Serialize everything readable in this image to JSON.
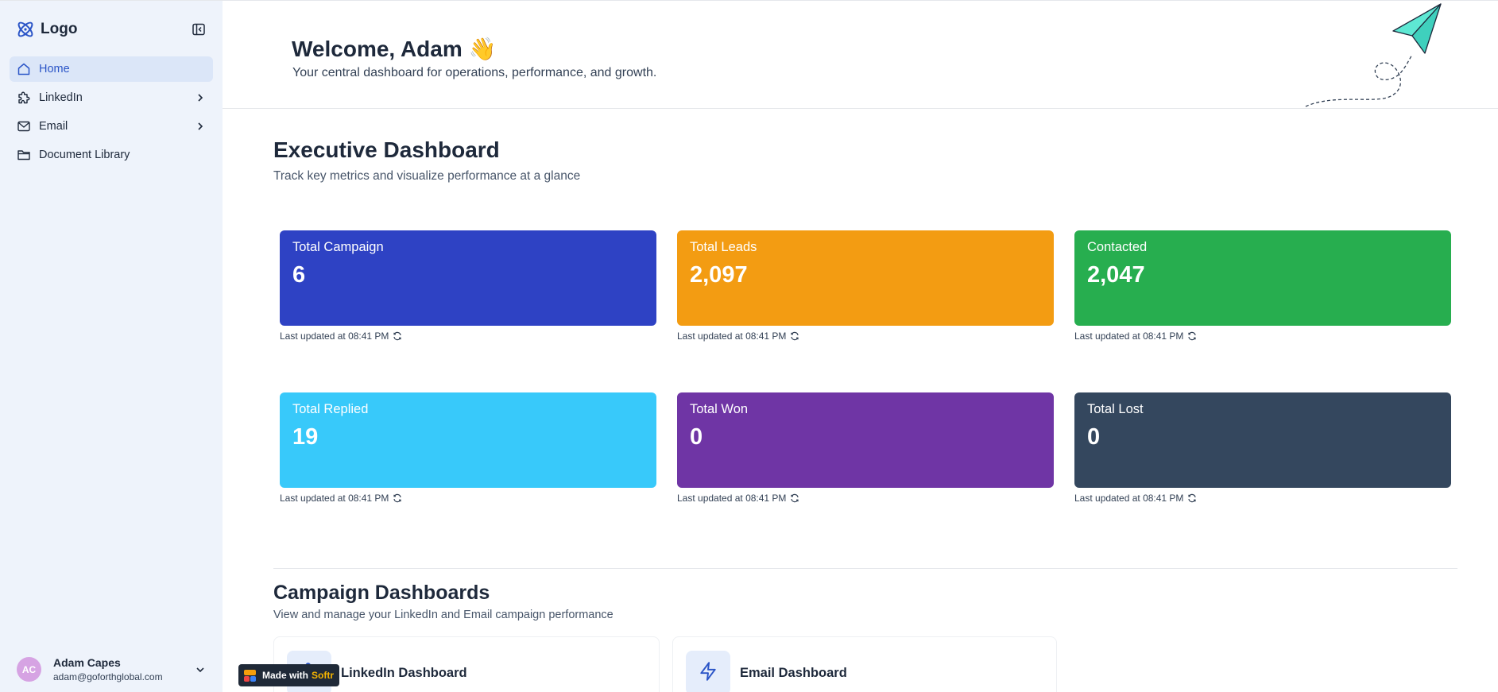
{
  "sidebar": {
    "brand": "Logo",
    "items": [
      {
        "label": "Home"
      },
      {
        "label": "LinkedIn"
      },
      {
        "label": "Email"
      },
      {
        "label": "Document Library"
      }
    ],
    "user": {
      "initials": "AC",
      "name": "Adam Capes",
      "email": "adam@goforthglobal.com"
    }
  },
  "header": {
    "welcome": "Welcome, Adam 👋",
    "subtitle": "Your central dashboard for operations, performance, and growth."
  },
  "executive": {
    "title": "Executive Dashboard",
    "subtitle": "Track key metrics and visualize performance at a glance",
    "cards": [
      {
        "label": "Total Campaign",
        "value": "6",
        "color": "#2e42c4",
        "updated": "Last updated at 08:41 PM"
      },
      {
        "label": "Total Leads",
        "value": "2,097",
        "color": "#f39c12",
        "updated": "Last updated at 08:41 PM"
      },
      {
        "label": "Contacted",
        "value": "2,047",
        "color": "#27ae4f",
        "updated": "Last updated at 08:41 PM"
      },
      {
        "label": "Total Replied",
        "value": "19",
        "color": "#38c9fa",
        "updated": "Last updated at 08:41 PM"
      },
      {
        "label": "Total Won",
        "value": "0",
        "color": "#6f35a5",
        "updated": "Last updated at 08:41 PM"
      },
      {
        "label": "Total Lost",
        "value": "0",
        "color": "#34475e",
        "updated": "Last updated at 08:41 PM"
      }
    ]
  },
  "campaigns": {
    "title": "Campaign Dashboards",
    "subtitle": "View and manage your LinkedIn and Email campaign performance",
    "items": [
      {
        "label": "LinkedIn Dashboard"
      },
      {
        "label": "Email Dashboard"
      }
    ]
  },
  "badge": {
    "prefix": "Made with",
    "name": "Softr"
  }
}
